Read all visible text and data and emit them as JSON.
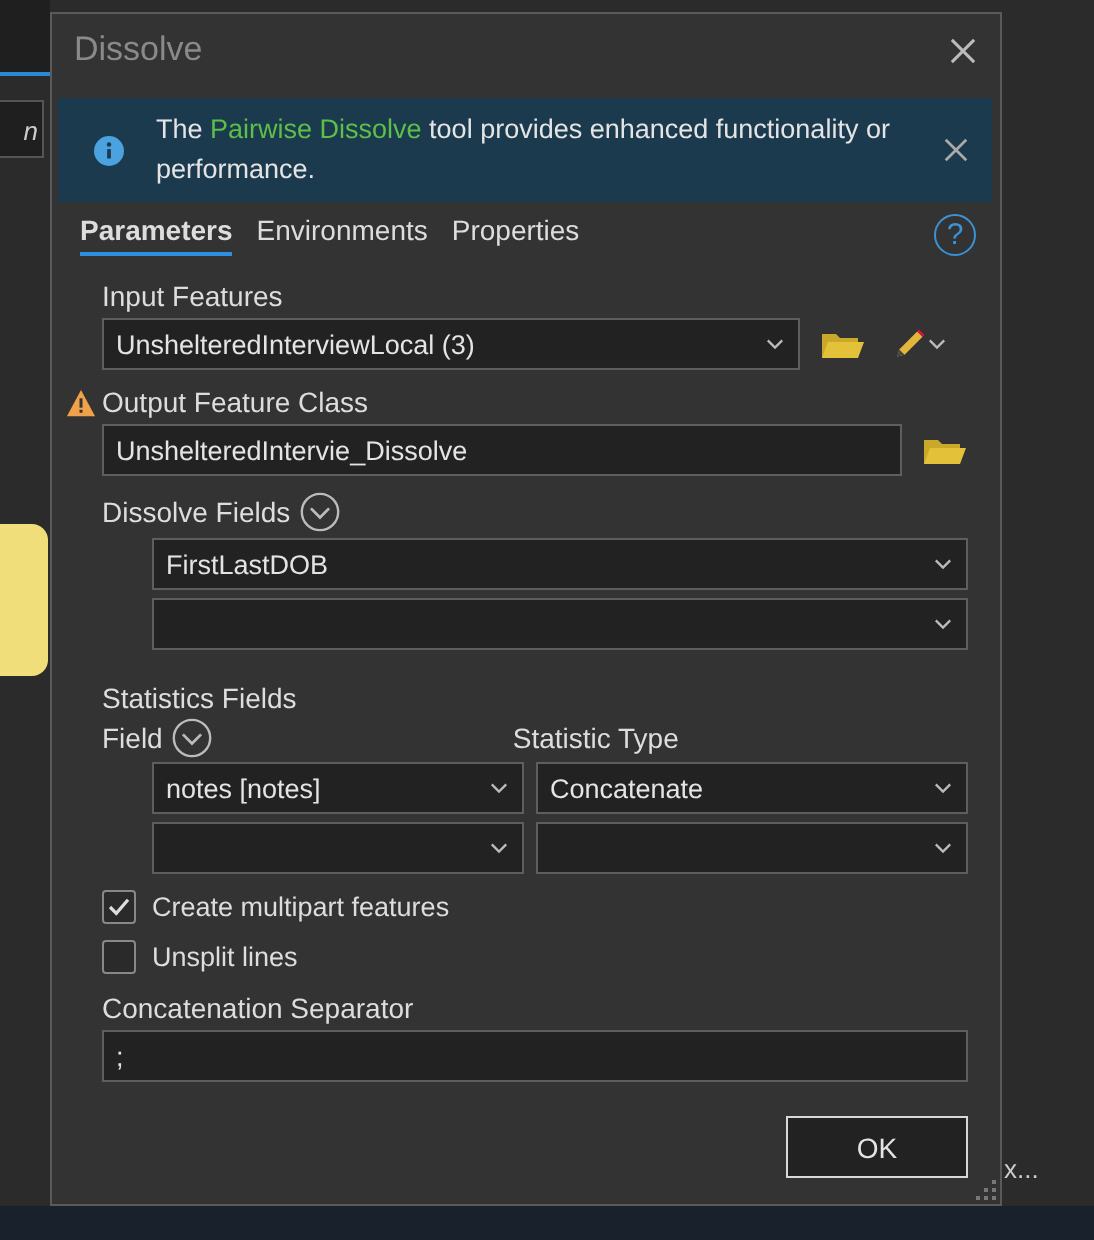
{
  "background": {
    "left_field_fragment": "n",
    "bottom_fragments": [
      "x..."
    ]
  },
  "window": {
    "title": "Dissolve"
  },
  "banner": {
    "text_before": "The ",
    "link": "Pairwise Dissolve",
    "text_after": " tool provides enhanced functionality or performance."
  },
  "tabs": [
    {
      "label": "Parameters",
      "selected": true
    },
    {
      "label": "Environments",
      "selected": false
    },
    {
      "label": "Properties",
      "selected": false
    }
  ],
  "help": "?",
  "input_features": {
    "label": "Input Features",
    "value": "UnshelteredInterviewLocal (3)"
  },
  "output_feature_class": {
    "label": "Output Feature Class",
    "value": "UnshelteredIntervie_Dissolve",
    "warning": true
  },
  "dissolve_fields": {
    "label": "Dissolve Fields",
    "rows": [
      {
        "value": "FirstLastDOB"
      },
      {}
    ]
  },
  "statistics_fields": {
    "label": "Statistics Fields",
    "field_header": "Field",
    "type_header": "Statistic Type",
    "rows": [
      {
        "field": "notes [notes]",
        "type": "Concatenate"
      },
      {}
    ]
  },
  "options": [
    {
      "label": "Create multipart features",
      "checked": true
    },
    {
      "label": "Unsplit lines",
      "checked": false
    }
  ],
  "separator": {
    "label": "Concatenation Separator",
    "value": ";"
  },
  "buttons": [
    "OK"
  ]
}
